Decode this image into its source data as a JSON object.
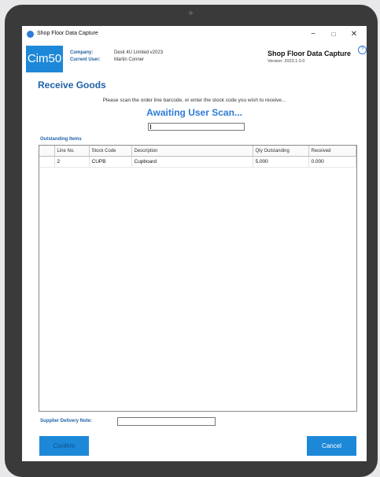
{
  "window": {
    "title": "Shop Floor Data Capture",
    "minimize": "−",
    "maximize": "□",
    "close": "✕"
  },
  "header": {
    "logo": "Cim50",
    "company_label": "Company:",
    "company_value": "Desk 4U Limited v2023",
    "user_label": "Current User:",
    "user_value": "Martin Conner",
    "app_name": "Shop Floor Data Capture",
    "version": "Version: 2023.1.0.0",
    "help_icon": "?"
  },
  "page": {
    "title": "Receive Goods",
    "instruction": "Please scan the order line barcode, or enter the stock code you wish to receive...",
    "status": "Awaiting User Scan...",
    "section_label": "Outstanding Items"
  },
  "table": {
    "columns": [
      "Line No.",
      "Stock Code",
      "Description",
      "Qty Outstanding",
      "Received"
    ],
    "rows": [
      {
        "line_no": "2",
        "stock_code": "CUPB",
        "description": "Cupboard",
        "qty_outstanding": "5.000",
        "received": "0.000"
      }
    ]
  },
  "footer": {
    "supplier_note_label": "Supplier Delivery Note:",
    "supplier_note_value": "",
    "confirm": "Confirm",
    "cancel": "Cancel"
  },
  "colors": {
    "accent": "#1e88d8",
    "heading": "#1e62a8",
    "status": "#2f7bd6",
    "device": "#3a3a3b"
  }
}
